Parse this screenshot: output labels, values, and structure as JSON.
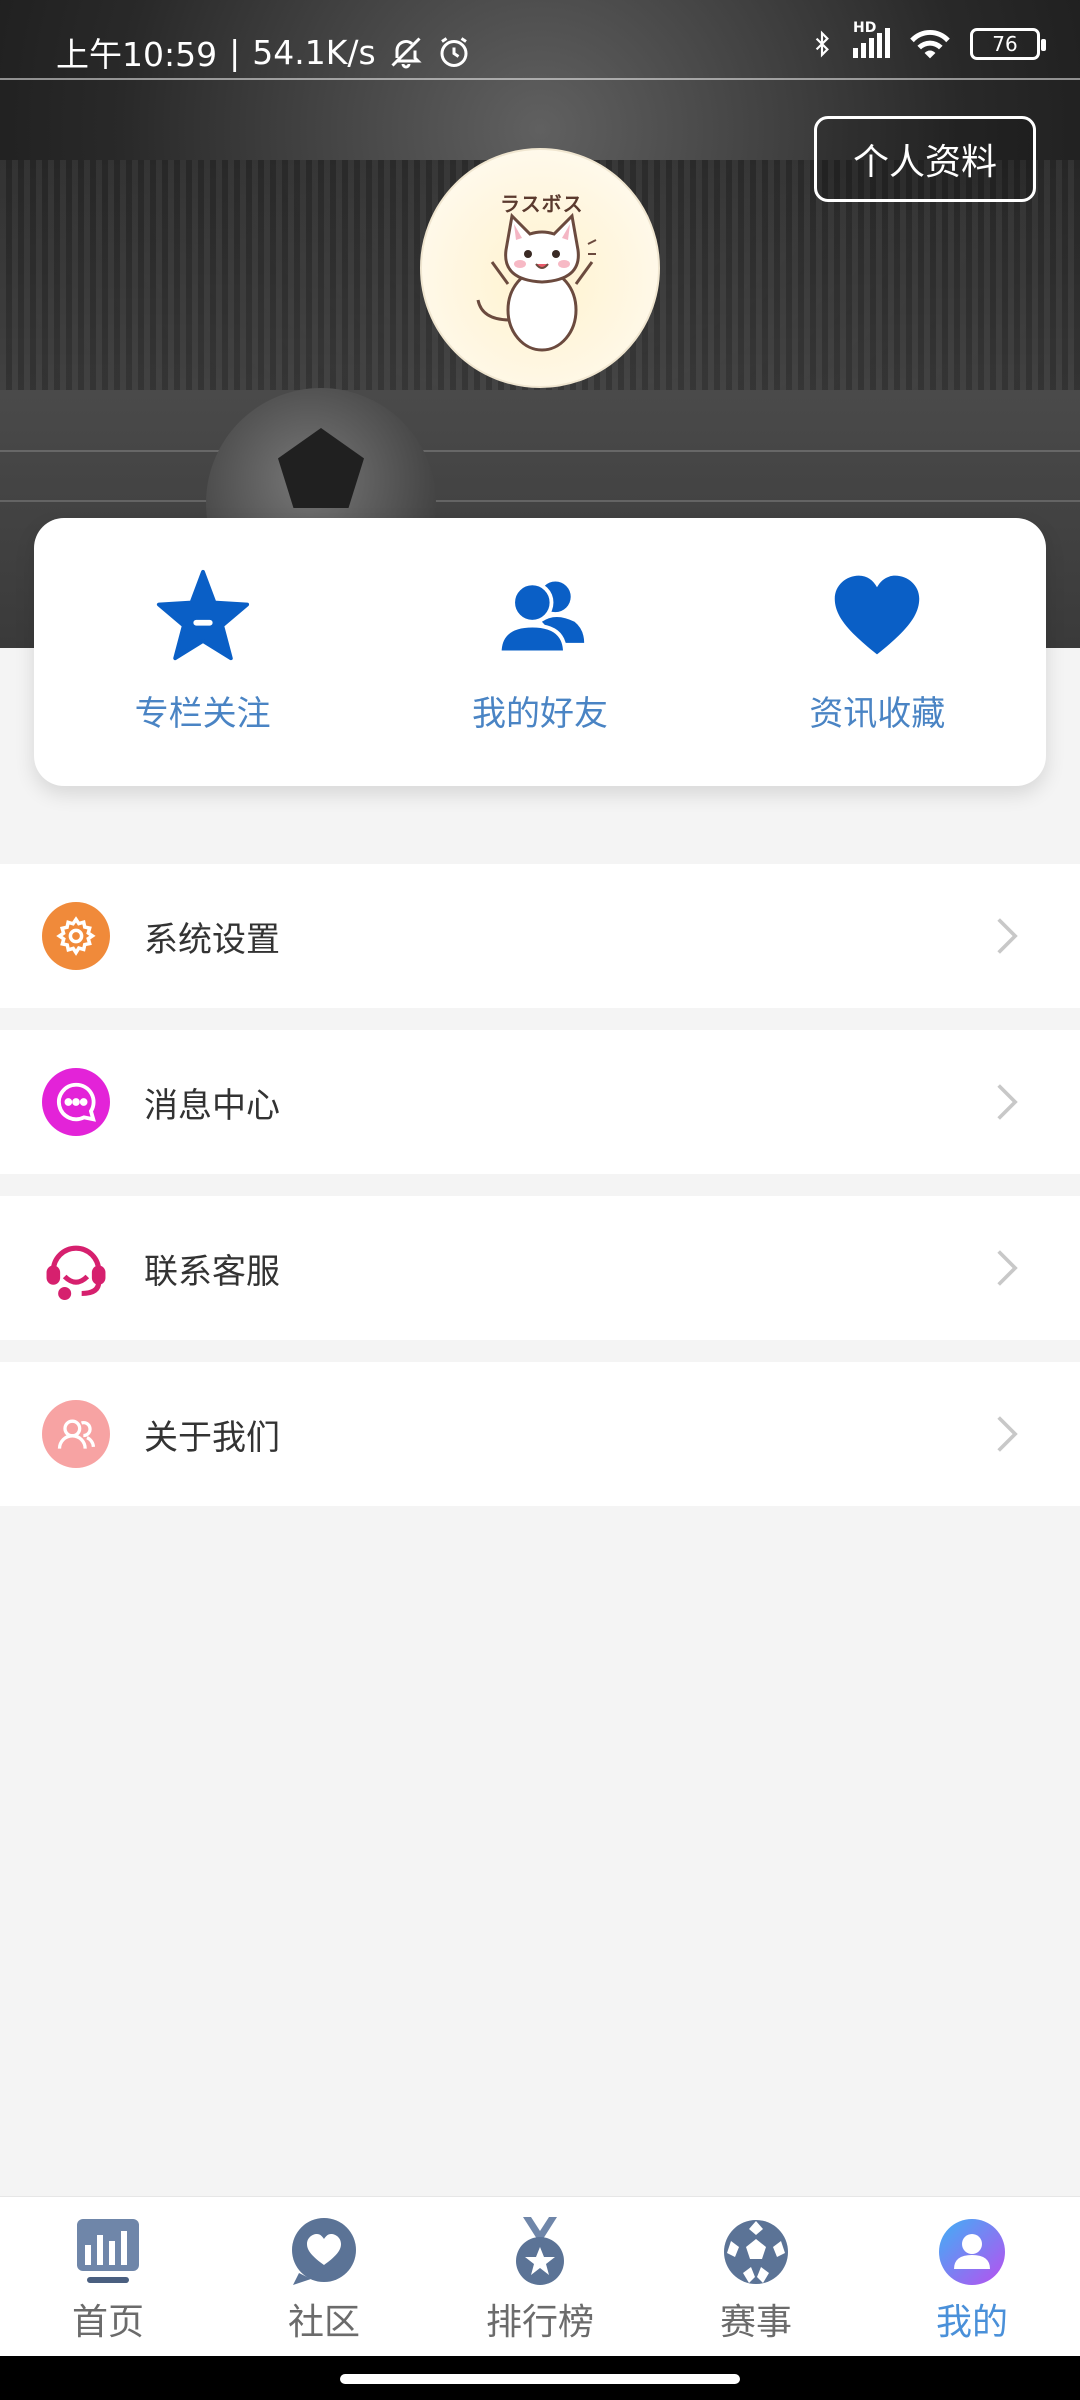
{
  "status_bar": {
    "time": "上午10:59",
    "separator": "|",
    "net_speed": "54.1K/s",
    "battery": "76",
    "hd": "HD"
  },
  "header": {
    "profile_button": "个人资料",
    "avatar_text": "ラスボス"
  },
  "quick_actions": [
    {
      "label": "专栏关注",
      "icon": "star-icon",
      "color": "#0a5fc6"
    },
    {
      "label": "我的好友",
      "icon": "friends-icon",
      "color": "#0a5fc6"
    },
    {
      "label": "资讯收藏",
      "icon": "heart-icon",
      "color": "#0a5fc6"
    }
  ],
  "menu": [
    {
      "label": "系统设置",
      "icon": "gear-icon",
      "color": "#f08a3a"
    },
    {
      "label": "消息中心",
      "icon": "chat-icon",
      "color": "#e323d8"
    },
    {
      "label": "联系客服",
      "icon": "headset-icon",
      "color": "#d6206e"
    },
    {
      "label": "关于我们",
      "icon": "people-icon",
      "color": "#f7a3a3"
    }
  ],
  "bottom_nav": [
    {
      "label": "首页",
      "icon": "chart-board-icon",
      "active": false
    },
    {
      "label": "社区",
      "icon": "heart-bubble-icon",
      "active": false
    },
    {
      "label": "排行榜",
      "icon": "medal-icon",
      "active": false
    },
    {
      "label": "赛事",
      "icon": "soccer-ball-icon",
      "active": false
    },
    {
      "label": "我的",
      "icon": "user-icon",
      "active": true
    }
  ],
  "colors": {
    "accent_blue": "#0a5fc6",
    "label_blue": "#4a84c4",
    "nav_active": "#4a90d9"
  }
}
